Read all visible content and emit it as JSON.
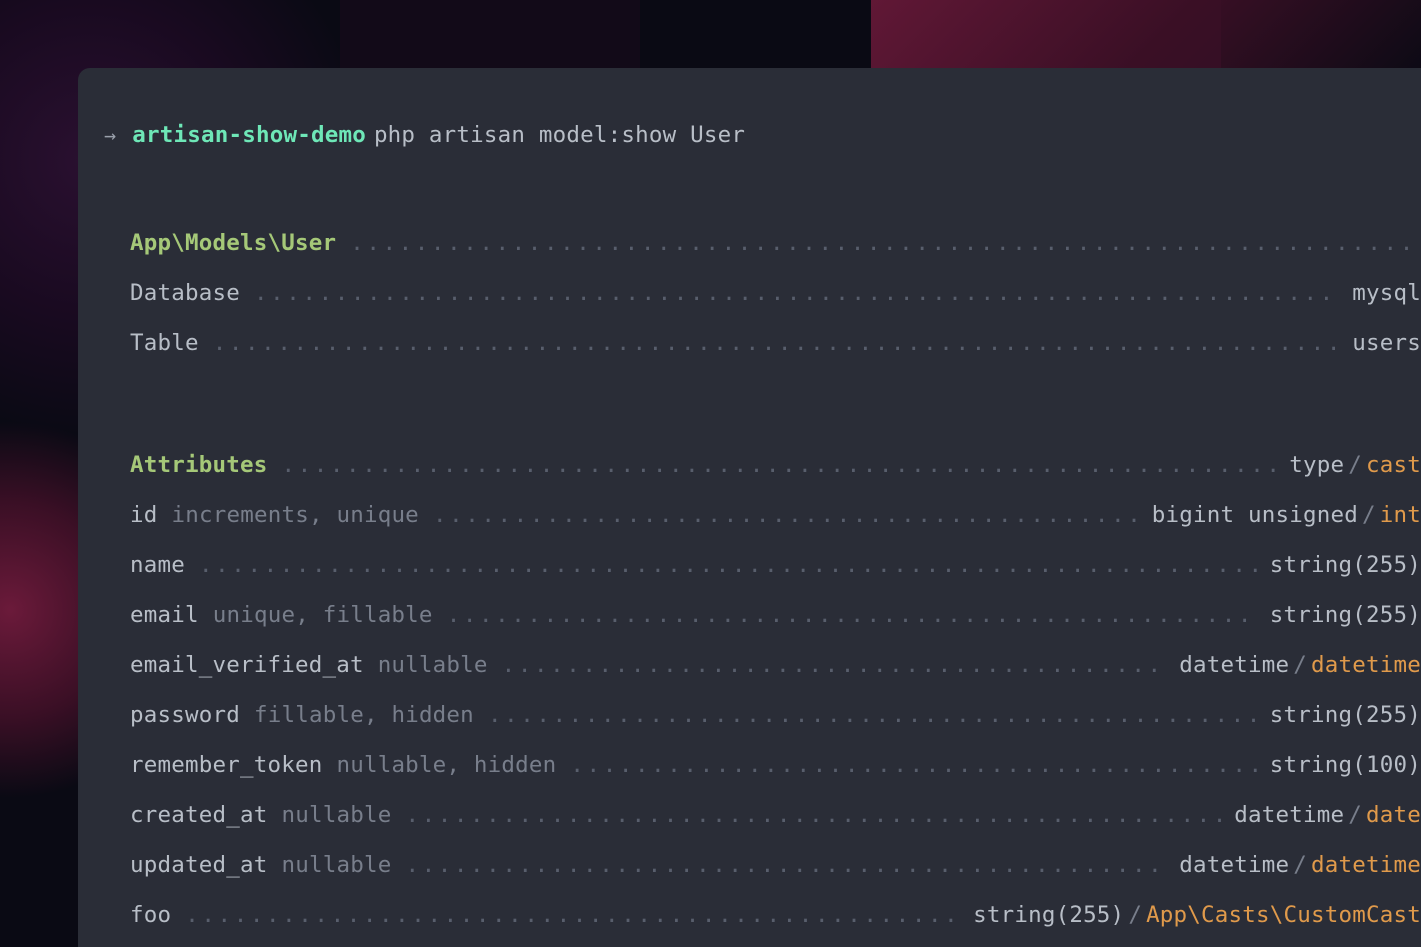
{
  "prompt": {
    "arrow": "→",
    "dir": "artisan-show-demo",
    "command": "php artisan model:show User"
  },
  "header": {
    "model": "App\\Models\\User",
    "database": {
      "label": "Database",
      "value": "mysql"
    },
    "table": {
      "label": "Table",
      "value": "users"
    }
  },
  "attributes_header": {
    "label": "Attributes",
    "type": "type",
    "cast": "cast"
  },
  "attributes": [
    {
      "name": "id",
      "meta": "increments, unique",
      "type": "bigint unsigned",
      "cast": "int"
    },
    {
      "name": "name",
      "meta": "",
      "type": "string(255)",
      "cast": ""
    },
    {
      "name": "email",
      "meta": "unique, fillable",
      "type": "string(255)",
      "cast": ""
    },
    {
      "name": "email_verified_at",
      "meta": "nullable",
      "type": "datetime",
      "cast": "datetime"
    },
    {
      "name": "password",
      "meta": "fillable, hidden",
      "type": "string(255)",
      "cast": ""
    },
    {
      "name": "remember_token",
      "meta": "nullable, hidden",
      "type": "string(100)",
      "cast": ""
    },
    {
      "name": "created_at",
      "meta": "nullable",
      "type": "datetime",
      "cast": "date"
    },
    {
      "name": "updated_at",
      "meta": "nullable",
      "type": "datetime",
      "cast": "datetime"
    },
    {
      "name": "foo",
      "meta": "",
      "type": "string(255)",
      "cast": "App\\Casts\\CustomCast"
    }
  ],
  "dots": "...................................................................................................................................................",
  "sep": "/"
}
